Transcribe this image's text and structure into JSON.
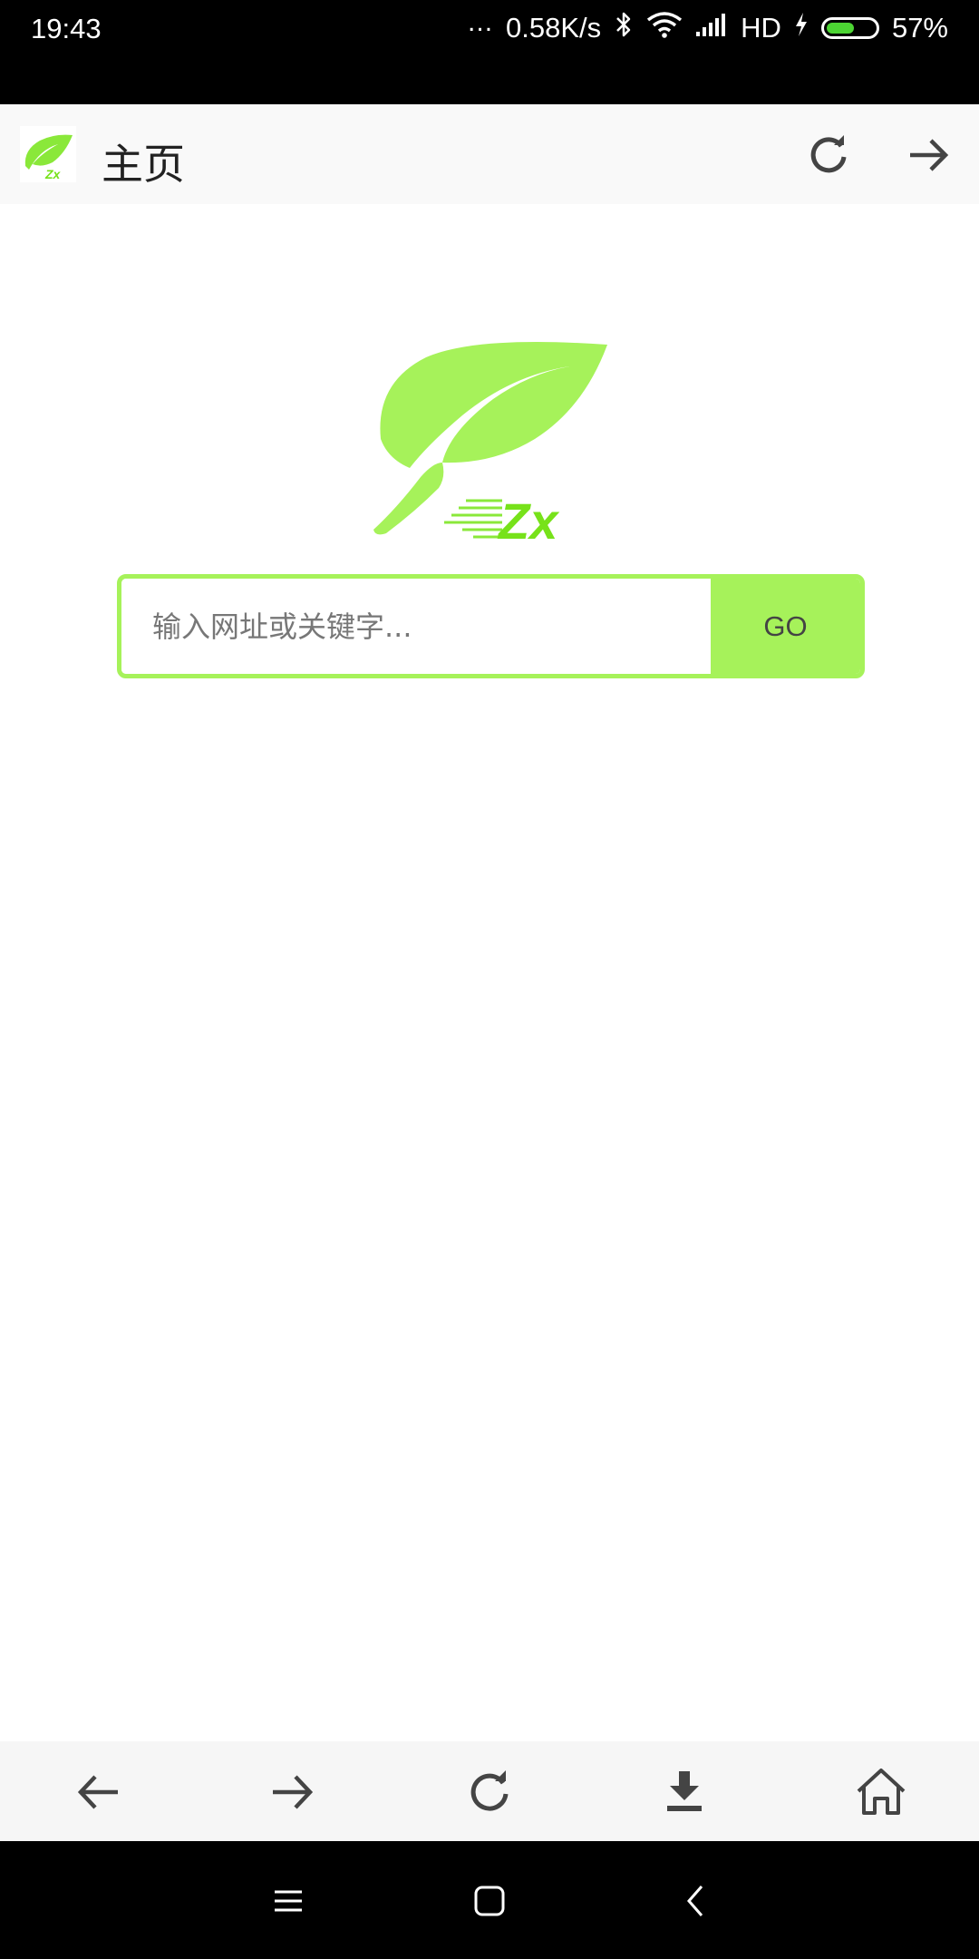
{
  "status_bar": {
    "time": "19:43",
    "more": "...",
    "network_speed": "0.58K/s",
    "network_type": "HD",
    "battery_percent": "57%",
    "battery_level": 0.57
  },
  "header": {
    "title": "主页"
  },
  "logo": {
    "text": "Zx"
  },
  "search": {
    "placeholder": "输入网址或关键字...",
    "go_label": "GO"
  },
  "toolbar": {
    "items": [
      {
        "icon": "back-arrow-icon"
      },
      {
        "icon": "forward-arrow-icon"
      },
      {
        "icon": "refresh-icon"
      },
      {
        "icon": "download-icon"
      },
      {
        "icon": "home-icon"
      }
    ]
  },
  "nav_bar": {
    "items": [
      {
        "icon": "menu-icon"
      },
      {
        "icon": "home-square-icon"
      },
      {
        "icon": "back-chevron-icon"
      }
    ]
  },
  "colors": {
    "accent": "#a6f25a",
    "logo_green": "#8ae83a",
    "battery_green": "#4cd433",
    "icon_gray": "#444444"
  }
}
